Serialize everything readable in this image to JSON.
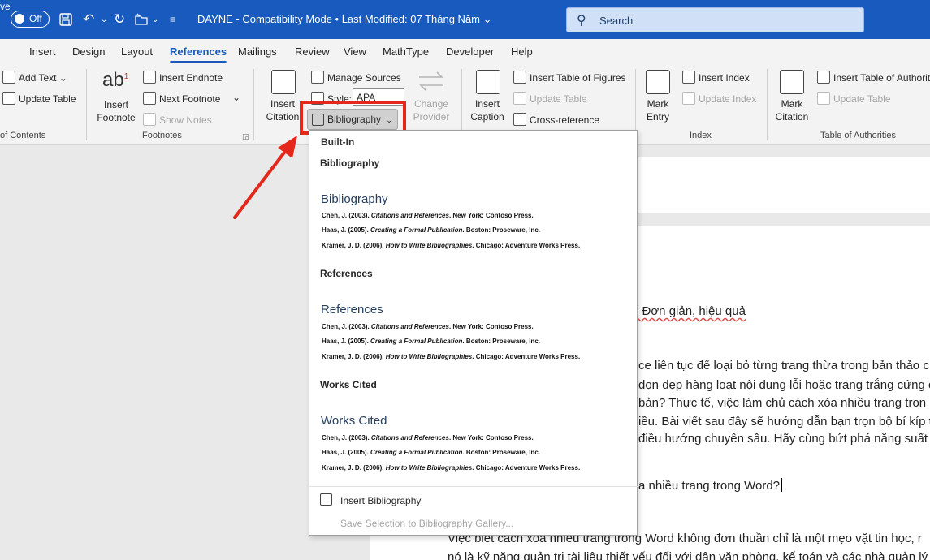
{
  "titlebar": {
    "autosave_label": "ve",
    "autosave_state": "Off",
    "doc_title": "DAYNE  -  Compatibility Mode  •  Last Modified: 07 Tháng Năm  ⌄"
  },
  "search": {
    "placeholder": "Search"
  },
  "tabs": [
    "Insert",
    "Design",
    "Layout",
    "References",
    "Mailings",
    "Review",
    "View",
    "MathType",
    "Developer",
    "Help"
  ],
  "ribbon": {
    "toc": {
      "add_text": "Add Text ⌄",
      "update_table": "Update Table",
      "group": "of Contents"
    },
    "footnotes": {
      "insert_footnote": "Insert Footnote",
      "insert_endnote": "Insert Endnote",
      "next_footnote": "Next Footnote",
      "show_notes": "Show Notes",
      "group": "Footnotes"
    },
    "citations": {
      "insert_citation": "Insert Citation",
      "manage_sources": "Manage Sources",
      "style_label": "Style:",
      "style_value": "APA",
      "bibliography": "Bibliography",
      "change_provider": "Change Provider"
    },
    "captions": {
      "insert_caption": "Insert Caption",
      "insert_table_of_figures": "Insert Table of Figures",
      "update_table": "Update Table",
      "cross_reference": "Cross-reference"
    },
    "index": {
      "mark_entry": "Mark Entry",
      "insert_index": "Insert Index",
      "update_index": "Update Index",
      "group": "Index"
    },
    "authorities": {
      "mark_citation": "Mark Citation",
      "insert_table": "Insert Table of Authoriti",
      "update_table": "Update Table",
      "group": "Table of Authorities"
    }
  },
  "dropdown": {
    "header": "Built-In",
    "entries": [
      {
        "label": "Bibliography",
        "heading": "Bibliography",
        "refs": [
          {
            "pre": "Chen, J. (2003). ",
            "title": "Citations and References",
            "post": ". New York: Contoso Press."
          },
          {
            "pre": "Haas, J. (2005). ",
            "title": "Creating a Formal Publication",
            "post": ". Boston: Proseware, Inc."
          },
          {
            "pre": "Kramer, J. D. (2006). ",
            "title": "How to Write Bibliographies",
            "post": ". Chicago: Adventure Works Press."
          }
        ]
      },
      {
        "label": "References",
        "heading": "References",
        "refs": [
          {
            "pre": "Chen, J. (2003). ",
            "title": "Citations and References",
            "post": ". New York: Contoso Press."
          },
          {
            "pre": "Haas, J. (2005). ",
            "title": "Creating a Formal Publication",
            "post": ". Boston: Proseware, Inc."
          },
          {
            "pre": "Kramer, J. D. (2006). ",
            "title": "How to Write Bibliographies",
            "post": ". Chicago: Adventure Works Press."
          }
        ]
      },
      {
        "label": "Works Cited",
        "heading": "Works Cited",
        "refs": [
          {
            "pre": "Chen, J. (2003). ",
            "title": "Citations and References",
            "post": ". New York: Contoso Press."
          },
          {
            "pre": "Haas, J. (2005). ",
            "title": "Creating a Formal Publication",
            "post": ". Boston: Proseware, Inc."
          },
          {
            "pre": "Kramer, J. D. (2006). ",
            "title": "How to Write Bibliographies",
            "post": ". Chicago: Adventure Works Press."
          }
        ]
      }
    ],
    "insert_bibliography": "Insert Bibliography",
    "save_selection": "Save Selection to Bibliography Gallery..."
  },
  "document": {
    "lines": [
      "d Đơn giản, hiệu quả",
      "ce liên tục để loại bỏ từng trang thừa trong bản thảo c",
      "dọn dẹp hàng loạt nội dung lỗi hoặc trang trắng cứng c",
      " bản? Thực tế, việc làm chủ cách xóa nhiều trang tron",
      "iều. Bài viết sau đây sẽ hướng dẫn bạn trọn bộ bí kíp t",
      " điều hướng chuyên sâu. Hãy cùng bứt phá năng suất",
      "a nhiều trang trong Word?",
      "Việc biết cách xóa nhiều trang trong Word không đơn thuần chỉ là một mẹo vặt tin học, r",
      "nó là kỹ năng quản trị tài liệu thiết yếu đối với dân văn phòng, kế toán và các nhà quản lý"
    ]
  },
  "colors": {
    "titlebar": "#185abd",
    "accent": "#185abd",
    "highlight": "#e5271b"
  }
}
